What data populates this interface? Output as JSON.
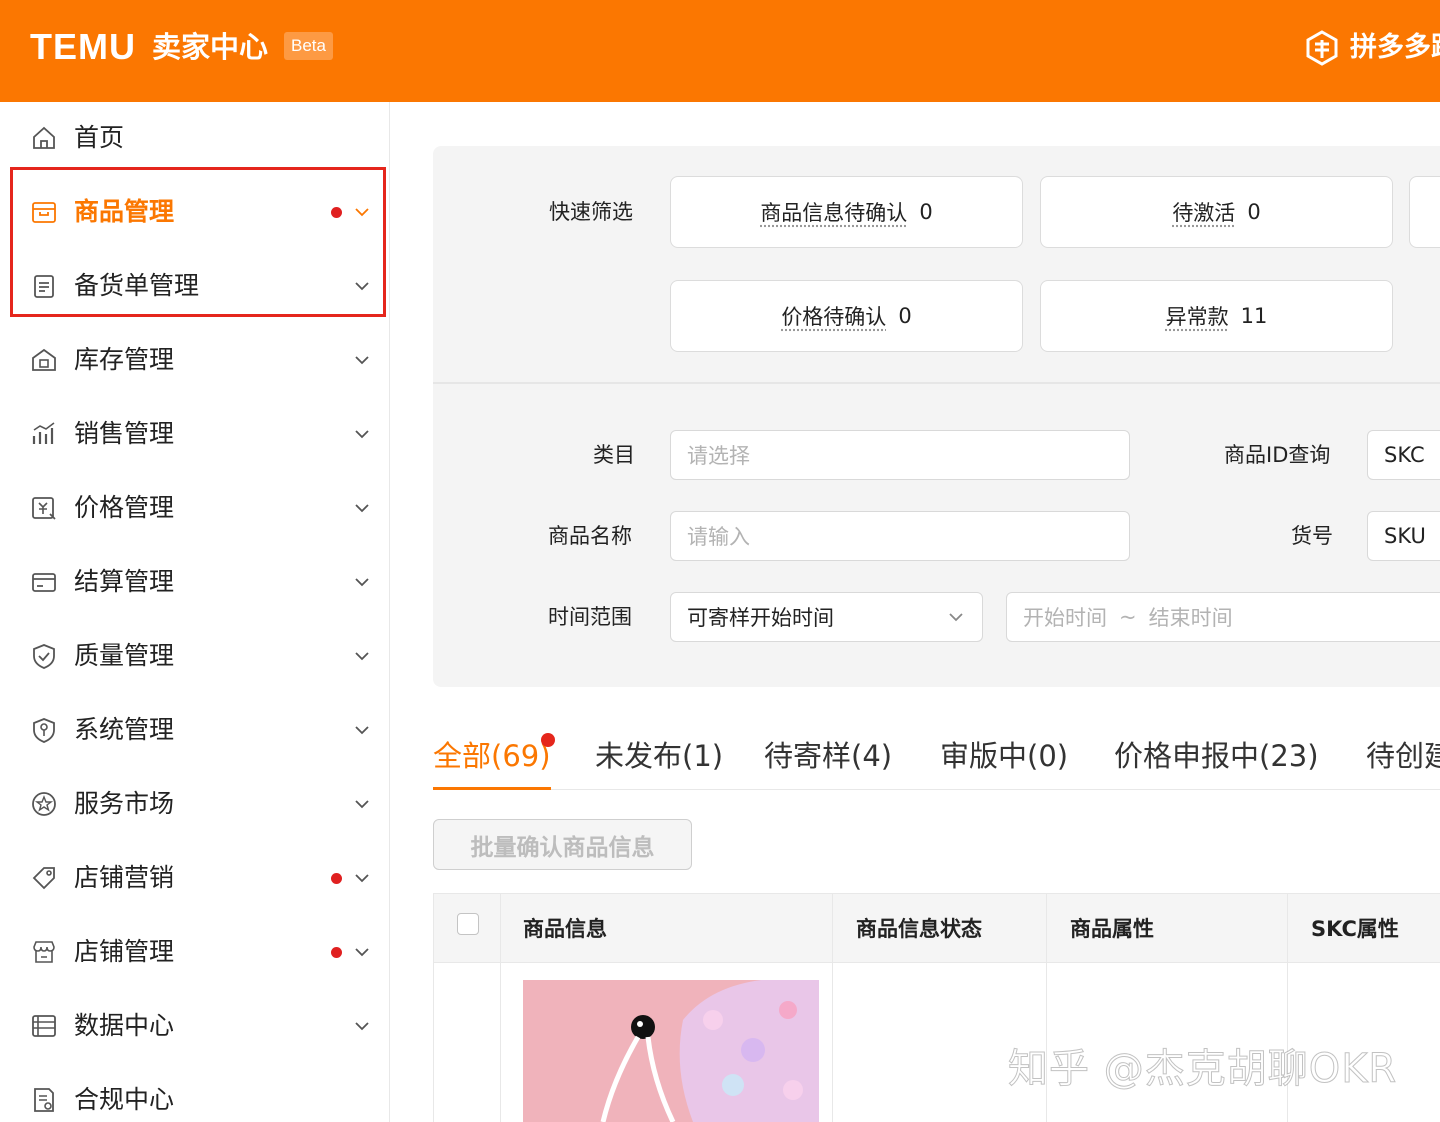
{
  "header": {
    "logo": "TEMU",
    "title": "卖家中心",
    "badge": "Beta",
    "brand": "拼多多跨"
  },
  "colors": {
    "accent": "#fb7701",
    "highlight": "#e5261c",
    "dot": "#e02020"
  },
  "sidebar": {
    "items": [
      {
        "label": "首页",
        "icon": "home-icon",
        "has_dot": false,
        "has_chevron": false,
        "active": false
      },
      {
        "label": "商品管理",
        "icon": "product-box-icon",
        "has_dot": true,
        "has_chevron": true,
        "active": true
      },
      {
        "label": "备货单管理",
        "icon": "clipboard-icon",
        "has_dot": false,
        "has_chevron": true,
        "active": false
      },
      {
        "label": "库存管理",
        "icon": "warehouse-icon",
        "has_dot": false,
        "has_chevron": true,
        "active": false
      },
      {
        "label": "销售管理",
        "icon": "bar-chart-icon",
        "has_dot": false,
        "has_chevron": true,
        "active": false
      },
      {
        "label": "价格管理",
        "icon": "price-tag-icon",
        "has_dot": false,
        "has_chevron": true,
        "active": false
      },
      {
        "label": "结算管理",
        "icon": "card-icon",
        "has_dot": false,
        "has_chevron": true,
        "active": false
      },
      {
        "label": "质量管理",
        "icon": "shield-check-icon",
        "has_dot": false,
        "has_chevron": true,
        "active": false
      },
      {
        "label": "系统管理",
        "icon": "shield-key-icon",
        "has_dot": false,
        "has_chevron": true,
        "active": false
      },
      {
        "label": "服务市场",
        "icon": "star-badge-icon",
        "has_dot": false,
        "has_chevron": true,
        "active": false
      },
      {
        "label": "店铺营销",
        "icon": "tag-icon",
        "has_dot": true,
        "has_chevron": true,
        "active": false
      },
      {
        "label": "店铺管理",
        "icon": "store-icon",
        "has_dot": true,
        "has_chevron": true,
        "active": false
      },
      {
        "label": "数据中心",
        "icon": "data-list-icon",
        "has_dot": false,
        "has_chevron": true,
        "active": false
      },
      {
        "label": "合规中心",
        "icon": "compliance-doc-icon",
        "has_dot": false,
        "has_chevron": false,
        "active": false
      }
    ]
  },
  "filters": {
    "quick_label": "快速筛选",
    "quick": [
      {
        "label": "商品信息待确认",
        "count": "0"
      },
      {
        "label": "待激活",
        "count": "0"
      },
      {
        "label": "价格待确认",
        "count": "0"
      },
      {
        "label": "异常款",
        "count": "11"
      }
    ],
    "category_label": "类目",
    "category_placeholder": "请选择",
    "product_id_label": "商品ID查询",
    "product_id_type": "SKC",
    "name_label": "商品名称",
    "name_placeholder": "请输入",
    "item_no_label": "货号",
    "item_no_type": "SKU",
    "time_label": "时间范围",
    "time_type": "可寄样开始时间",
    "start_placeholder": "开始时间",
    "range_sep": "~",
    "end_placeholder": "结束时间"
  },
  "tabs": [
    {
      "label": "全部(69)",
      "active": true
    },
    {
      "label": "未发布(1)",
      "active": false
    },
    {
      "label": "待寄样(4)",
      "active": false
    },
    {
      "label": "审版中(0)",
      "active": false
    },
    {
      "label": "价格申报中(23)",
      "active": false
    },
    {
      "label": "待创建",
      "active": false
    }
  ],
  "batch_button": "批量确认商品信息",
  "table": {
    "columns": [
      "商品信息",
      "商品信息状态",
      "商品属性",
      "SKC属性"
    ]
  },
  "watermark": "知乎 @杰克胡聊OKR"
}
